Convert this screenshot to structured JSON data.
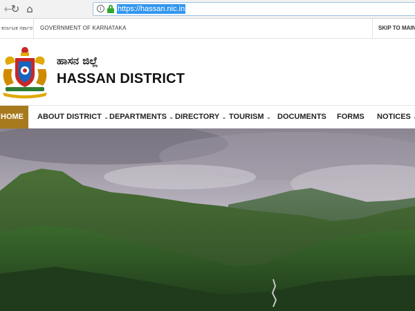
{
  "browser": {
    "url": "https://hassan.nic.in",
    "icons": [
      "back-icon",
      "reload-icon",
      "home-icon",
      "info-icon",
      "lock-icon"
    ]
  },
  "top_strip": {
    "kannada_govt": "ಕರ್ನಾಟಕ ಸರ್ಕಾರ",
    "government_label": "GOVERNMENT OF KARNATAKA",
    "skip_link": "SKIP TO MAIN"
  },
  "header": {
    "title_kannada": "ಹಾಸನ ಜಿಲ್ಲೆ",
    "title_english": "HASSAN DISTRICT"
  },
  "nav": {
    "items": [
      {
        "label": "HOME",
        "active": true,
        "dropdown": false
      },
      {
        "label": "ABOUT DISTRICT",
        "active": false,
        "dropdown": true
      },
      {
        "label": "DEPARTMENTS",
        "active": false,
        "dropdown": true
      },
      {
        "label": "DIRECTORY",
        "active": false,
        "dropdown": true
      },
      {
        "label": "TOURISM",
        "active": false,
        "dropdown": true
      },
      {
        "label": "DOCUMENTS",
        "active": false,
        "dropdown": false
      },
      {
        "label": "FORMS",
        "active": false,
        "dropdown": false
      },
      {
        "label": "NOTICES",
        "active": false,
        "dropdown": true
      }
    ]
  },
  "colors": {
    "nav_active": "#a87a1e",
    "url_highlight": "#3296f0",
    "lock_green": "#2eaa2e"
  }
}
